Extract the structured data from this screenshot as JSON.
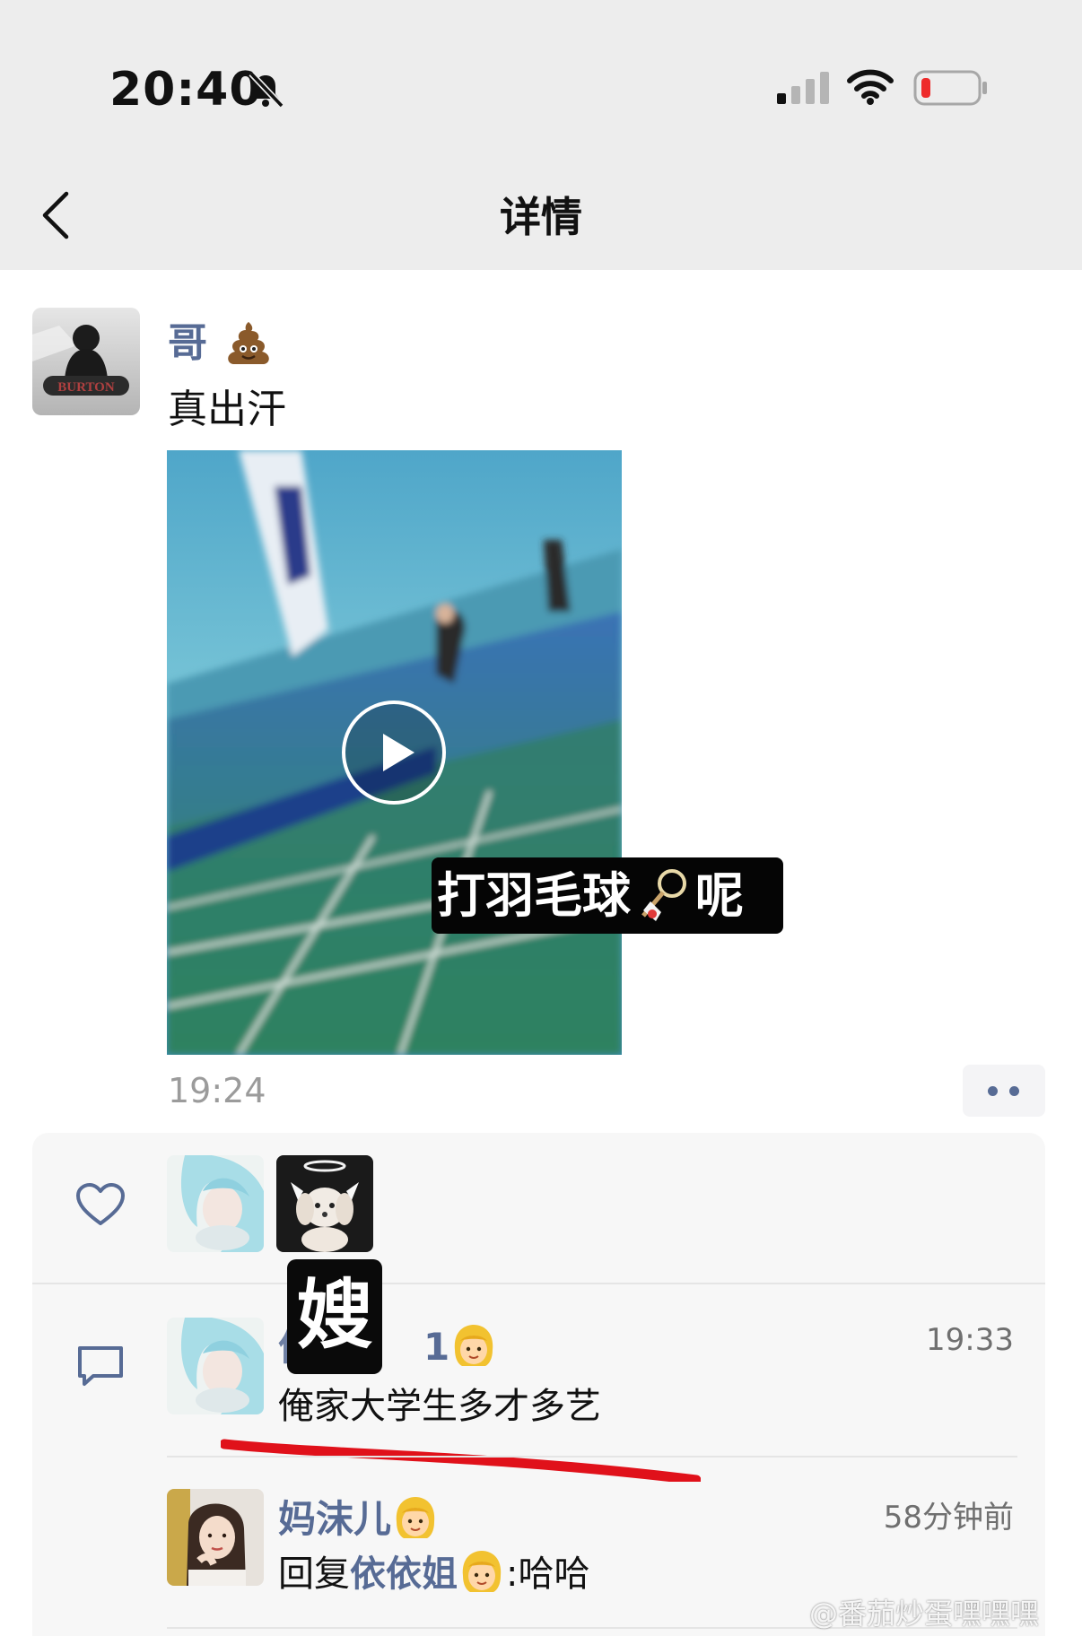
{
  "status_bar": {
    "time": "20:40"
  },
  "nav": {
    "title": "详情"
  },
  "post": {
    "author": "哥",
    "text": "真出汗",
    "video_caption": "打羽毛球",
    "video_caption_suffix": "呢",
    "time": "19:24"
  },
  "comments": [
    {
      "overlay": "嫂",
      "text": "俺家大学生多才多艺",
      "time": "19:33"
    },
    {
      "name": "妈沫儿",
      "reply_prefix": "回复",
      "reply_target": "依依姐",
      "reply_text": "哈哈",
      "time": "58分钟前"
    }
  ],
  "watermark": "@番茄炒蛋嘿嘿嘿",
  "icons": {
    "muted": "bell-slash-icon",
    "more": "more-dots-icon",
    "like": "heart-icon",
    "comment": "comment-icon"
  },
  "colors": {
    "link": "#576b95",
    "background_bar": "#ededed",
    "annotation": "#e0111a"
  }
}
